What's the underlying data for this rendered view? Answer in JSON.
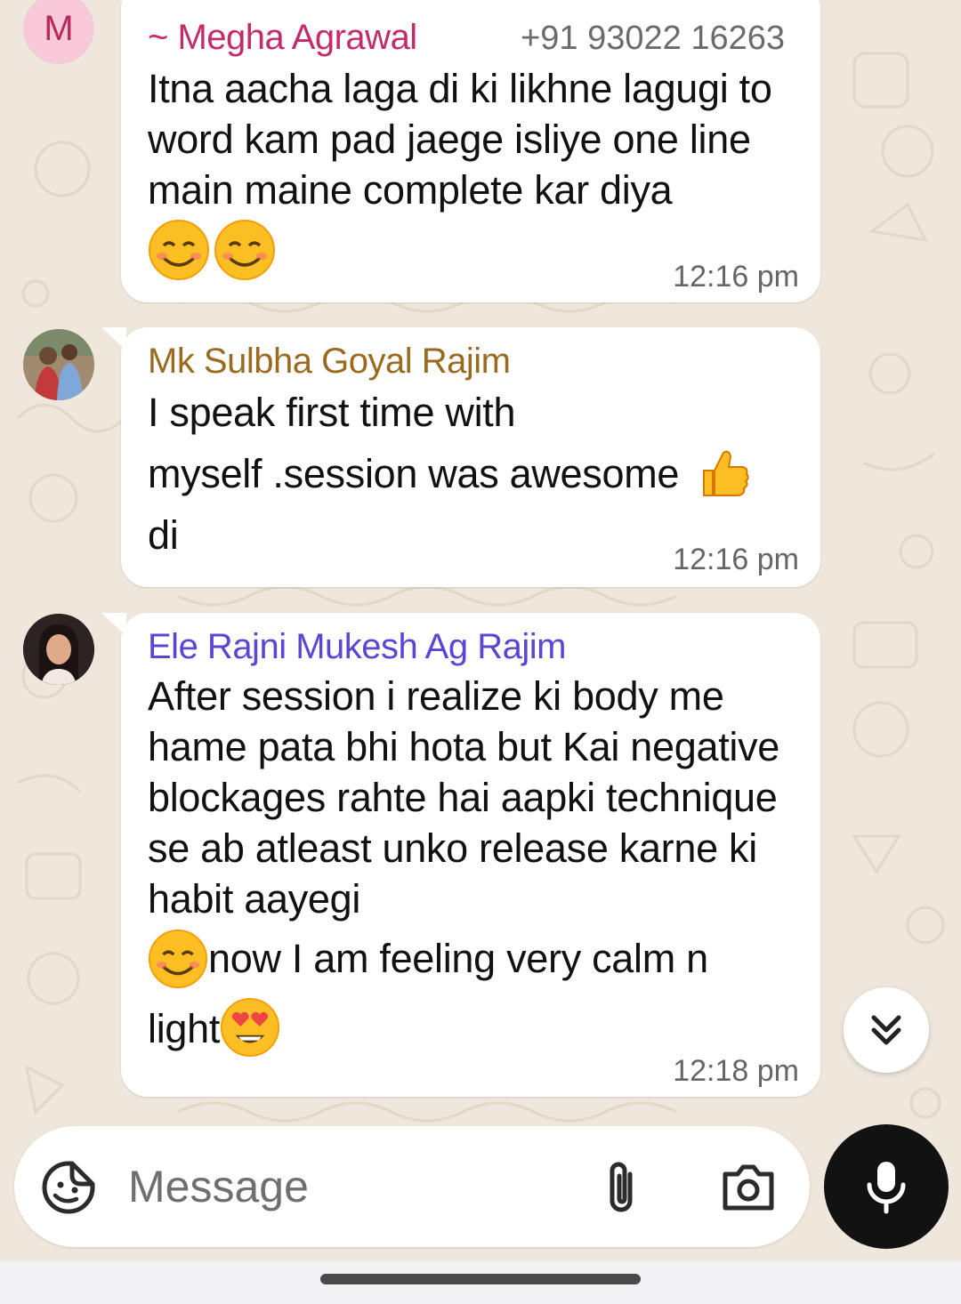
{
  "messages": [
    {
      "avatar_letter": "M",
      "sender": "~ Megha Agrawal",
      "phone": "+91 93022 16263",
      "text": "Itna aacha laga di ki likhne lagugi to word kam pad jaege isliye one line main maine complete kar diya",
      "emojis": [
        "smiling-face-icon",
        "smiling-face-icon"
      ],
      "time": "12:16 pm"
    },
    {
      "sender": "Mk Sulbha Goyal Rajim",
      "text_line1": "I speak first time with",
      "text_line2": "myself .session was awesome",
      "text_line3": "di",
      "emojis": [
        "thumbs-up-icon"
      ],
      "time": "12:16 pm"
    },
    {
      "sender": "Ele Rajni Mukesh Ag Rajim",
      "text": "After session i realize ki body me hame pata bhi hota but Kai negative blockages rahte hai aapki technique se ab atleast unko release karne ki habit aayegi",
      "text_line2": "now I am feeling very calm n",
      "text_line3": "light",
      "emojis": [
        "smiling-face-icon",
        "heart-eyes-icon"
      ],
      "time": "12:18 pm"
    }
  ],
  "composer": {
    "placeholder": "Message"
  },
  "colors": {
    "sender1": "#c42b6a",
    "sender2": "#9a6a1e",
    "sender3": "#5b45d6",
    "background": "#efe7dc",
    "mic_button": "#121212"
  }
}
